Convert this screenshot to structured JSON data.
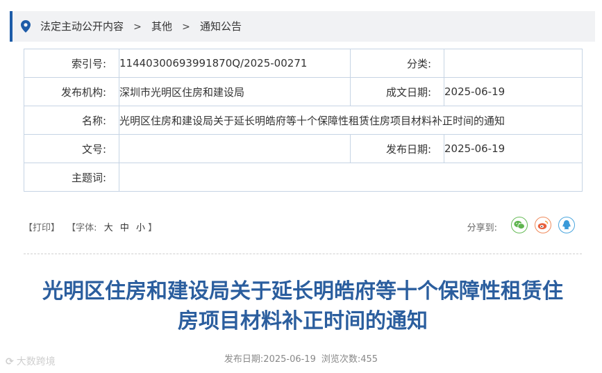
{
  "breadcrumb": {
    "items": [
      "法定主动公开内容",
      "其他",
      "通知公告"
    ],
    "separator": ">"
  },
  "meta_table": {
    "index_no_label": "索引号:",
    "index_no": "11440300693991870Q/2025-00271",
    "category_label": "分类:",
    "category": "",
    "publisher_label": "发布机构:",
    "publisher": "深圳市光明区住房和建设局",
    "created_date_label": "成文日期:",
    "created_date": "2025-06-19",
    "name_label": "名称:",
    "name": "光明区住房和建设局关于延长明皓府等十个保障性租赁住房项目材料补正时间的通知",
    "doc_no_label": "文号:",
    "doc_no": "",
    "publish_date_label": "发布日期:",
    "publish_date": "2025-06-19",
    "keywords_label": "主题词:",
    "keywords": ""
  },
  "tools": {
    "print": "【打印】",
    "font_prefix": "【字体:",
    "font_large": "大",
    "font_medium": "中",
    "font_small": "小",
    "font_suffix": "】",
    "share_label": "分享到:",
    "share_icons": [
      "wechat-icon",
      "weibo-icon",
      "qq-icon"
    ]
  },
  "article": {
    "title_line1": "光明区住房和建设局关于延长明皓府等十个保障性租赁住",
    "title_line2": "房项目材料补正时间的通知",
    "publish_date_label": "发布日期:",
    "publish_date": "2025-06-19",
    "views_label": "浏览次数:",
    "views": "455"
  },
  "watermark": "大数跨境",
  "colors": {
    "accent": "#1d5ca8",
    "title": "#2b5e9e",
    "table_border": "#c6d4e4",
    "crumb_bg": "#f1f2f4"
  }
}
